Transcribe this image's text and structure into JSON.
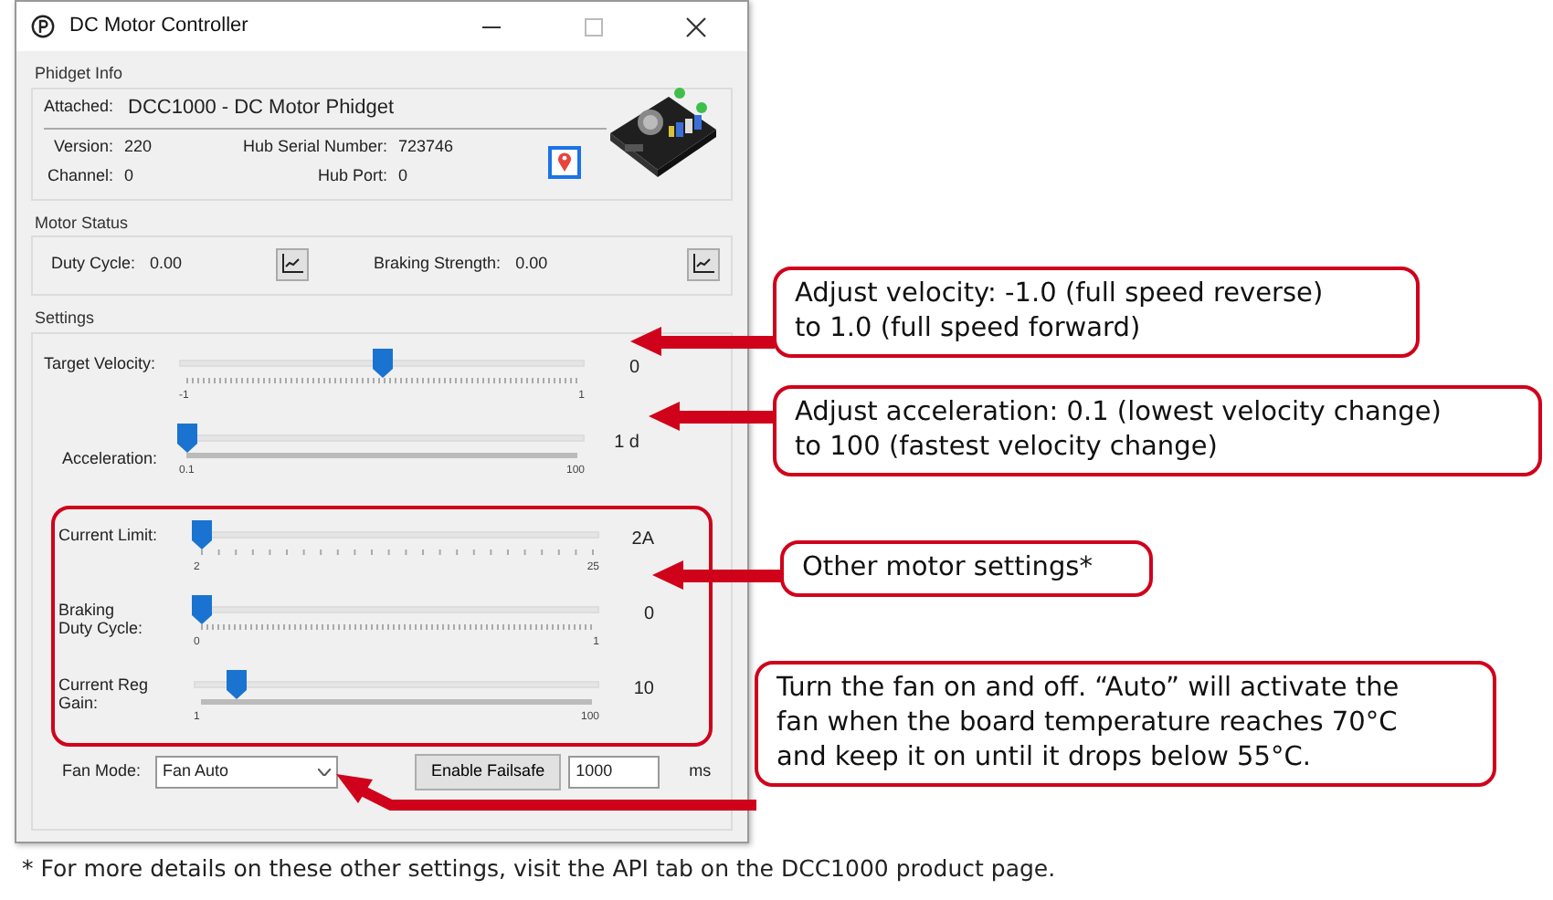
{
  "window": {
    "title": "DC Motor Controller"
  },
  "phidget_info": {
    "title": "Phidget Info",
    "attached_label": "Attached:",
    "attached_value": "DCC1000 - DC Motor Phidget",
    "fields": [
      {
        "label": "Version:",
        "value": "220"
      },
      {
        "label": "Hub Serial Number:",
        "value": "723746"
      },
      {
        "label": "Channel:",
        "value": "0"
      },
      {
        "label": "Hub Port:",
        "value": "0"
      }
    ]
  },
  "motor_status": {
    "title": "Motor Status",
    "readings": [
      {
        "label": "Duty Cycle:",
        "value": "0.00"
      },
      {
        "label": "Braking Strength:",
        "value": "0.00"
      }
    ]
  },
  "settings": {
    "title": "Settings",
    "sliders": [
      {
        "label": "Target Velocity:",
        "value": "0",
        "min": "-1",
        "max": "1",
        "level": 0.5,
        "kind": "fine"
      },
      {
        "label": "Acceleration:",
        "value": "1 d",
        "min": "0.1",
        "max": "100",
        "level": 0,
        "kind": "dense"
      }
    ],
    "other_settings": {
      "sliders": [
        {
          "label": "Current Limit:",
          "value": "2A",
          "min": "2",
          "max": "25",
          "level": 0,
          "kind": "coarse"
        },
        {
          "label": "Braking\nDuty Cycle:",
          "value": "0",
          "min": "0",
          "max": "1",
          "level": 0,
          "kind": "fine"
        },
        {
          "label": "Current Reg\nGain:",
          "value": "10",
          "min": "1",
          "max": "100",
          "level": 0.09,
          "kind": "dense"
        }
      ]
    },
    "fan_mode": {
      "label": "Fan Mode:",
      "value": "Fan Auto"
    },
    "failsafe_button": "Enable Failsafe",
    "failsafe_time": "1000",
    "failsafe_unit": "ms"
  },
  "callouts": [
    {
      "text": "Adjust velocity: -1.0 (full speed reverse)\nto 1.0 (full speed forward)"
    },
    {
      "text": "Adjust acceleration: 0.1 (lowest velocity change)\nto 100 (fastest velocity change)"
    },
    {
      "text": "Other motor settings*"
    },
    {
      "text": "Turn the fan on and off. “Auto” will activate the\nfan when the board temperature reaches 70°C\nand keep it on until it drops below 55°C."
    }
  ],
  "footnote": "* For more details on these other settings, visit the API tab on the DCC1000 product page."
}
